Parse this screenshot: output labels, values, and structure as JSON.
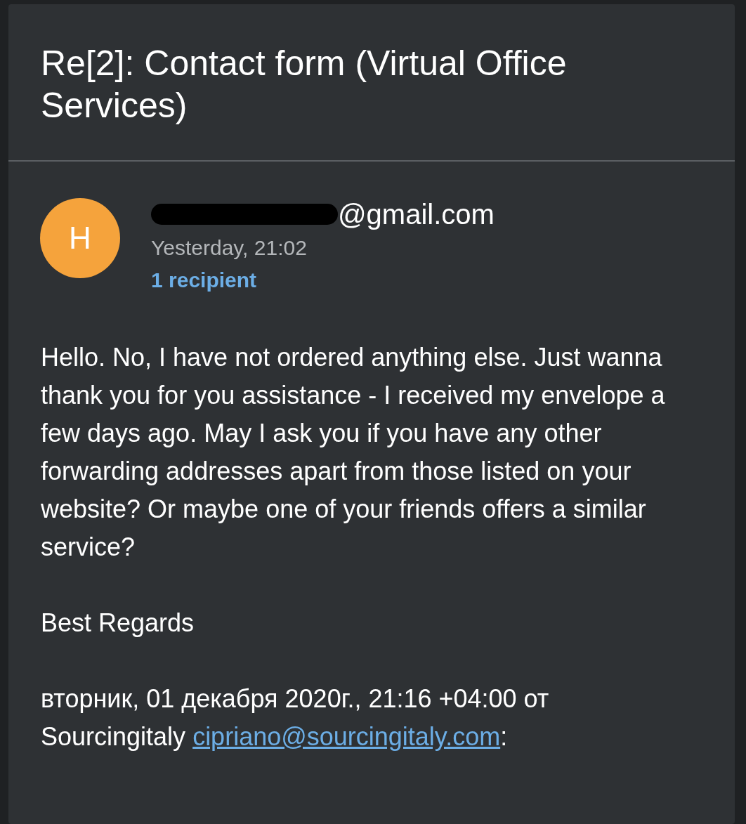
{
  "subject": "Re[2]: Contact form (Virtual Office Services)",
  "message": {
    "avatar_letter": "H",
    "sender_redacted": true,
    "sender": "@gmail.com",
    "date": "Yesterday, 21:02",
    "recipients": "1 recipient",
    "body": [
      "Hello. No, I have not ordered anything else. Just wanna thank you for you assistance - I received my envelope a few days ago. May I ask you if you have any other forwarding addresses apart from those listed on your website? Or maybe one of your friends offers a similar service?",
      "Best Regards"
    ],
    "quote_header": {
      "line": "вторник, 01 декабря 2020г., 21:16 +04:00 от",
      "name": "Sourcingitaly",
      "link": "cipriano@sourcingitaly.com",
      "suffix": ":"
    }
  }
}
